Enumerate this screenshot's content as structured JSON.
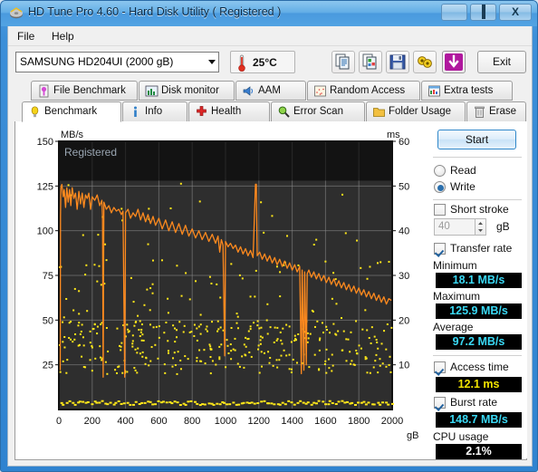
{
  "window": {
    "title": "HD Tune Pro 4.60 - Hard Disk Utility (  Registered )",
    "icon": "hdtune-app-icon",
    "minimize_label": "",
    "maximize_label": "",
    "close_label": "X"
  },
  "menu": {
    "items": [
      {
        "label": "File",
        "accel": "F"
      },
      {
        "label": "Help",
        "accel": "H"
      }
    ]
  },
  "toolbar": {
    "drive": "SAMSUNG HD204UI (2000 gB)",
    "temperature": "25°C",
    "temp_icon": "thermometer-icon",
    "buttons": [
      {
        "name": "copy-icon",
        "title": "Copy"
      },
      {
        "name": "copy-image-icon",
        "title": "Copy image"
      },
      {
        "name": "save-icon",
        "title": "Save"
      },
      {
        "name": "settings-icon",
        "title": "Settings"
      },
      {
        "name": "download-icon",
        "title": "Download"
      }
    ],
    "exit_label": "Exit"
  },
  "tabs": {
    "row1": [
      {
        "label": "File Benchmark",
        "icon": "file-benchmark-icon",
        "active": false
      },
      {
        "label": "Disk monitor",
        "icon": "disk-monitor-icon",
        "active": false
      },
      {
        "label": "AAM",
        "icon": "speaker-icon",
        "active": false
      },
      {
        "label": "Random Access",
        "icon": "random-access-icon",
        "active": false
      },
      {
        "label": "Extra tests",
        "icon": "extra-tests-icon",
        "active": false
      }
    ],
    "row2": [
      {
        "label": "Benchmark",
        "icon": "bulb-icon",
        "active": true
      },
      {
        "label": "Info",
        "icon": "info-icon",
        "active": false
      },
      {
        "label": "Health",
        "icon": "health-cross-icon",
        "active": false
      },
      {
        "label": "Error Scan",
        "icon": "magnifier-icon",
        "active": false
      },
      {
        "label": "Folder Usage",
        "icon": "folder-icon",
        "active": false
      },
      {
        "label": "Erase",
        "icon": "trash-icon",
        "active": false
      }
    ]
  },
  "panel": {
    "start_label": "Start",
    "mode": {
      "read_label": "Read",
      "write_label": "Write",
      "selected": "Write"
    },
    "short_stroke": {
      "label": "Short stroke",
      "checked": false,
      "value": "40",
      "unit": "gB"
    },
    "transfer_rate": {
      "label": "Transfer rate",
      "checked": true
    },
    "minimum_label": "Minimum",
    "minimum_value": "18.1 MB/s",
    "maximum_label": "Maximum",
    "maximum_value": "125.9 MB/s",
    "average_label": "Average",
    "average_value": "97.2 MB/s",
    "access_time": {
      "label": "Access time",
      "checked": true,
      "value": "12.1 ms"
    },
    "burst_rate": {
      "label": "Burst rate",
      "checked": true,
      "value": "148.7 MB/s"
    },
    "cpu_usage_label": "CPU usage",
    "cpu_usage_value": "2.1%"
  },
  "chart_data": {
    "type": "line",
    "title": "",
    "watermark": "Registered",
    "xlabel": "gB",
    "ylabel": "MB/s",
    "y2label": "ms",
    "xlim": [
      0,
      2000
    ],
    "ylim": [
      0,
      150
    ],
    "y2lim": [
      0,
      60
    ],
    "xticks": [
      0,
      200,
      400,
      600,
      800,
      1000,
      1200,
      1400,
      1600,
      1800,
      2000
    ],
    "yticks": [
      25,
      50,
      75,
      100,
      125,
      150
    ],
    "y2ticks": [
      10,
      20,
      30,
      40,
      50,
      60
    ],
    "grid": true,
    "background": "#2e2e2e",
    "colors": {
      "transfer": "#ff8a1e",
      "access": "#ffe81a",
      "grid": "#8d8d8d"
    },
    "series": [
      {
        "name": "Transfer rate",
        "axis": "left",
        "unit": "MB/s",
        "color": "#ff8a1e",
        "points": [
          [
            8,
            22
          ],
          [
            10,
            108
          ],
          [
            12,
            124
          ],
          [
            18,
            125.9
          ],
          [
            26,
            119
          ],
          [
            32,
            123
          ],
          [
            40,
            113
          ],
          [
            48,
            124
          ],
          [
            56,
            116
          ],
          [
            64,
            123
          ],
          [
            72,
            114
          ],
          [
            80,
            124
          ],
          [
            90,
            118
          ],
          [
            100,
            121
          ],
          [
            110,
            112
          ],
          [
            120,
            122
          ],
          [
            130,
            115
          ],
          [
            140,
            121
          ],
          [
            150,
            113
          ],
          [
            160,
            120
          ],
          [
            170,
            118
          ],
          [
            180,
            121
          ],
          [
            190,
            112
          ],
          [
            200,
            119
          ],
          [
            215,
            117
          ],
          [
            230,
            120
          ],
          [
            245,
            114
          ],
          [
            258,
            117
          ],
          [
            262,
            108
          ],
          [
            266,
            18.1
          ],
          [
            270,
            116
          ],
          [
            285,
            112
          ],
          [
            300,
            114
          ],
          [
            315,
            110
          ],
          [
            330,
            113
          ],
          [
            345,
            111
          ],
          [
            360,
            112
          ],
          [
            375,
            109
          ],
          [
            385,
            111
          ],
          [
            395,
            18.1
          ],
          [
            400,
            110
          ],
          [
            415,
            112
          ],
          [
            430,
            107
          ],
          [
            445,
            110
          ],
          [
            460,
            108
          ],
          [
            475,
            112
          ],
          [
            490,
            106
          ],
          [
            505,
            110
          ],
          [
            520,
            105
          ],
          [
            535,
            109
          ],
          [
            550,
            104
          ],
          [
            565,
            108
          ],
          [
            580,
            103
          ],
          [
            600,
            107
          ],
          [
            620,
            101
          ],
          [
            640,
            106
          ],
          [
            660,
            100
          ],
          [
            680,
            105
          ],
          [
            700,
            99
          ],
          [
            720,
            104
          ],
          [
            740,
            98
          ],
          [
            760,
            103
          ],
          [
            780,
            97
          ],
          [
            800,
            101
          ],
          [
            820,
            96
          ],
          [
            840,
            100
          ],
          [
            860,
            95
          ],
          [
            880,
            99
          ],
          [
            900,
            94
          ],
          [
            920,
            98
          ],
          [
            940,
            93
          ],
          [
            955,
            97
          ],
          [
            965,
            88
          ],
          [
            975,
            95
          ],
          [
            985,
            92
          ],
          [
            995,
            30
          ],
          [
            1000,
            94
          ],
          [
            1015,
            91
          ],
          [
            1030,
            93
          ],
          [
            1045,
            90
          ],
          [
            1060,
            92
          ],
          [
            1075,
            88
          ],
          [
            1090,
            91
          ],
          [
            1105,
            87
          ],
          [
            1120,
            90
          ],
          [
            1135,
            86
          ],
          [
            1150,
            89
          ],
          [
            1165,
            85
          ],
          [
            1180,
            126
          ],
          [
            1185,
            126
          ],
          [
            1190,
            86
          ],
          [
            1205,
            88
          ],
          [
            1220,
            84
          ],
          [
            1235,
            87
          ],
          [
            1250,
            83
          ],
          [
            1265,
            86
          ],
          [
            1280,
            82
          ],
          [
            1295,
            85
          ],
          [
            1310,
            81
          ],
          [
            1325,
            84
          ],
          [
            1340,
            80
          ],
          [
            1355,
            83
          ],
          [
            1370,
            79
          ],
          [
            1385,
            82
          ],
          [
            1400,
            78
          ],
          [
            1415,
            81
          ],
          [
            1430,
            77
          ],
          [
            1445,
            80
          ],
          [
            1455,
            20
          ],
          [
            1460,
            78
          ],
          [
            1470,
            22
          ],
          [
            1475,
            77
          ],
          [
            1485,
            25
          ],
          [
            1490,
            76
          ],
          [
            1500,
            78
          ],
          [
            1515,
            74
          ],
          [
            1530,
            77
          ],
          [
            1545,
            73
          ],
          [
            1560,
            76
          ],
          [
            1575,
            72
          ],
          [
            1590,
            75
          ],
          [
            1605,
            71
          ],
          [
            1620,
            74
          ],
          [
            1635,
            70
          ],
          [
            1650,
            73
          ],
          [
            1665,
            69
          ],
          [
            1680,
            72
          ],
          [
            1695,
            68
          ],
          [
            1710,
            71
          ],
          [
            1725,
            67
          ],
          [
            1740,
            70
          ],
          [
            1755,
            66
          ],
          [
            1770,
            69
          ],
          [
            1785,
            65
          ],
          [
            1800,
            68
          ],
          [
            1815,
            64
          ],
          [
            1830,
            67
          ],
          [
            1845,
            63
          ],
          [
            1860,
            66
          ],
          [
            1875,
            62
          ],
          [
            1890,
            65
          ],
          [
            1905,
            61
          ],
          [
            1920,
            64
          ],
          [
            1935,
            60
          ],
          [
            1950,
            63
          ],
          [
            1965,
            59
          ],
          [
            1980,
            62
          ],
          [
            1995,
            61
          ]
        ]
      },
      {
        "name": "Access time",
        "axis": "right",
        "unit": "ms",
        "color": "#ffe81a",
        "style": "scatter",
        "mean": 12.1,
        "spread": [
          8,
          20
        ],
        "outliers_up_to": 52
      }
    ]
  }
}
